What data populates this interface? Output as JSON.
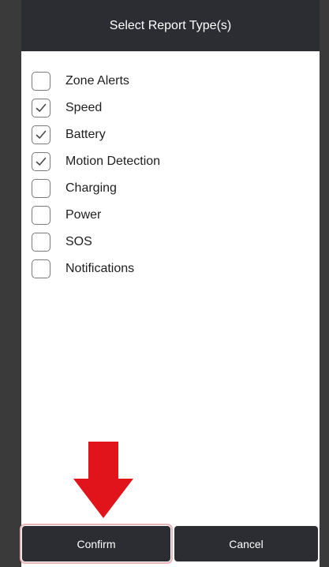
{
  "dialog": {
    "title": "Select Report Type(s)"
  },
  "options": [
    {
      "label": "Zone Alerts",
      "checked": false,
      "icon": "checkmark-icon"
    },
    {
      "label": "Speed",
      "checked": true,
      "icon": "checkmark-icon"
    },
    {
      "label": "Battery",
      "checked": true,
      "icon": "checkmark-icon"
    },
    {
      "label": "Motion Detection",
      "checked": true,
      "icon": "checkmark-icon"
    },
    {
      "label": "Charging",
      "checked": false,
      "icon": "checkmark-icon"
    },
    {
      "label": "Power",
      "checked": false,
      "icon": "checkmark-icon"
    },
    {
      "label": "SOS",
      "checked": false,
      "icon": "checkmark-icon"
    },
    {
      "label": "Notifications",
      "checked": false,
      "icon": "checkmark-icon"
    }
  ],
  "footer": {
    "confirm_label": "Confirm",
    "cancel_label": "Cancel"
  },
  "annotation": {
    "arrow_color": "#e1141b",
    "highlight_color": "#e9b5b9",
    "icon": "down-arrow-icon"
  },
  "colors": {
    "header": "#2b2d33",
    "button": "#2b2d33",
    "background": "#ffffff"
  }
}
